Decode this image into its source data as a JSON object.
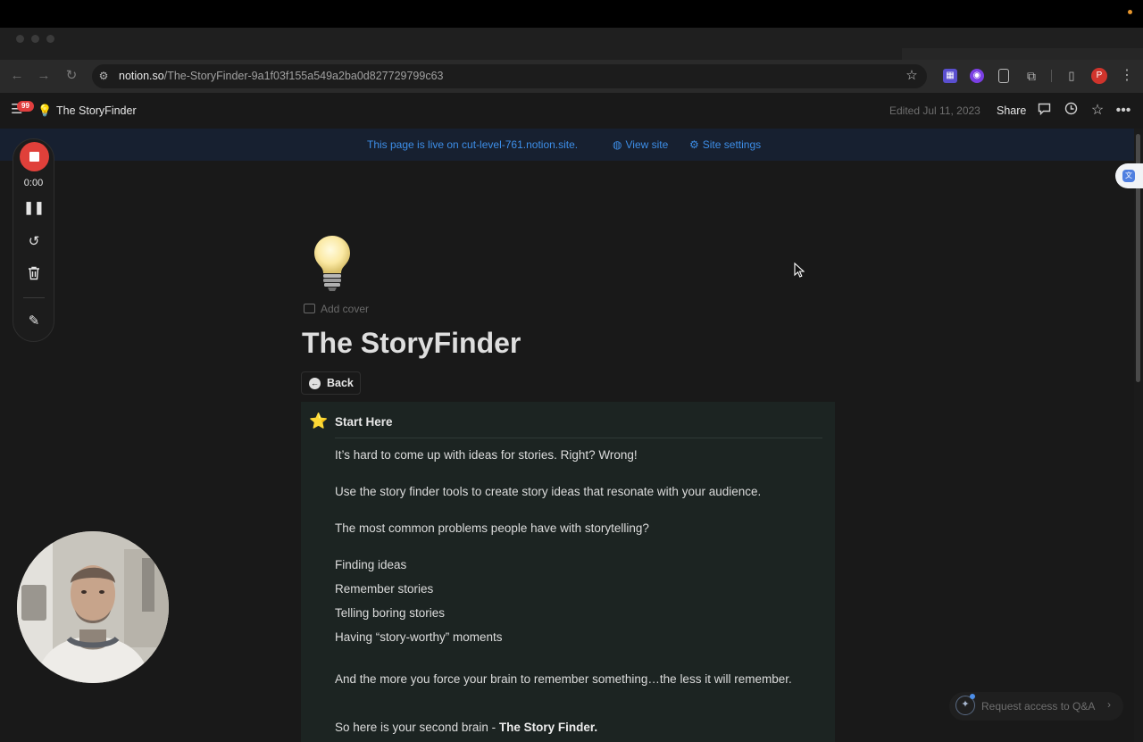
{
  "browser": {
    "url_host": "notion.so",
    "url_path": "/The-StoryFinder-9a1f03f155a549a2ba0d827729799c63",
    "profile_initial": "P",
    "icons": [
      "back-arrow-icon",
      "forward-arrow-icon",
      "reload-icon",
      "site-info-icon",
      "bookmark-star-icon",
      "extension-icon",
      "sidebar-icon",
      "more-vert-icon"
    ]
  },
  "notion_topbar": {
    "badge_count": "99",
    "page_icon": "💡",
    "breadcrumb": "The StoryFinder",
    "edited": "Edited Jul 11, 2023",
    "share_label": "Share"
  },
  "live_banner": {
    "text": "This page is live on cut-level-761.notion.site.",
    "view_site": "View site",
    "site_settings": "Site settings"
  },
  "recorder": {
    "time": "0:00"
  },
  "page": {
    "add_cover": "Add cover",
    "title": "The StoryFinder",
    "back_label": "Back"
  },
  "callout": {
    "icon": "⭐",
    "heading": "Start Here",
    "p1": "It’s hard to come up with ideas for stories. Right? Wrong!",
    "p2": "Use the story finder tools to create story ideas that resonate with your audience.",
    "p3": "The most common problems people have with storytelling?",
    "list": [
      "Finding ideas",
      "Remember stories",
      "Telling boring stories",
      "Having “story-worthy” moments"
    ],
    "p4": "And the more you force your brain to remember something…the less it will remember.",
    "p5_prefix": "So here is your second brain - ",
    "p5_bold": "The Story Finder."
  },
  "qa": {
    "label": "Request access to Q&A"
  },
  "colors": {
    "background": "#191919",
    "link_blue": "#3d8ee8",
    "record_red": "#e0403a",
    "callout_bg": "#1c2422"
  }
}
